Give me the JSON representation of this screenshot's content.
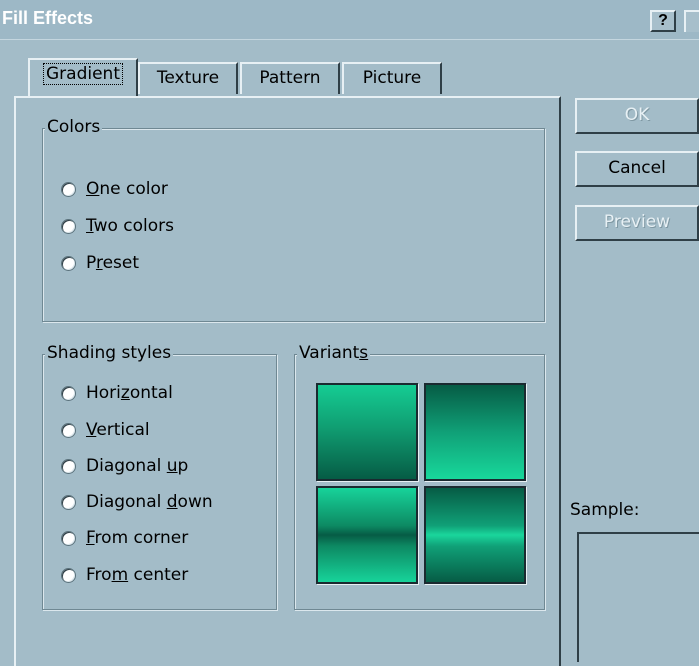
{
  "window": {
    "title": "Fill Effects",
    "help_label": "?"
  },
  "tabs": [
    {
      "label": "Gradient",
      "active": true
    },
    {
      "label": "Texture",
      "active": false
    },
    {
      "label": "Pattern",
      "active": false
    },
    {
      "label": "Picture",
      "active": false
    }
  ],
  "colors_group": {
    "legend": "Colors",
    "options": [
      {
        "pre": "",
        "mnemonic": "O",
        "post": "ne color",
        "selected": false
      },
      {
        "pre": "",
        "mnemonic": "T",
        "post": "wo colors",
        "selected": false
      },
      {
        "pre": "P",
        "mnemonic": "r",
        "post": "eset",
        "selected": false
      }
    ]
  },
  "shading_group": {
    "legend": "Shading styles",
    "options": [
      {
        "pre": "Hori",
        "mnemonic": "z",
        "post": "ontal",
        "selected": false
      },
      {
        "pre": "",
        "mnemonic": "V",
        "post": "ertical",
        "selected": false
      },
      {
        "pre": "Diagonal ",
        "mnemonic": "u",
        "post": "p",
        "selected": false
      },
      {
        "pre": "Diagonal ",
        "mnemonic": "d",
        "post": "own",
        "selected": false
      },
      {
        "pre": "",
        "mnemonic": "F",
        "post": "rom corner",
        "selected": false
      },
      {
        "pre": "Fro",
        "mnemonic": "m",
        "post": " center",
        "selected": false
      }
    ]
  },
  "variants_group": {
    "legend_pre": "Variant",
    "legend_mnemonic": "s",
    "legend_post": ""
  },
  "buttons": {
    "ok": {
      "label": "OK",
      "enabled": false
    },
    "cancel": {
      "label": "Cancel",
      "enabled": true
    },
    "preview": {
      "label": "Preview",
      "enabled": false
    }
  },
  "sample": {
    "label": "Sample:"
  },
  "colors": {
    "face": "#a3bcc8",
    "gradient_dark": "#065c45",
    "gradient_light": "#18d89b"
  }
}
